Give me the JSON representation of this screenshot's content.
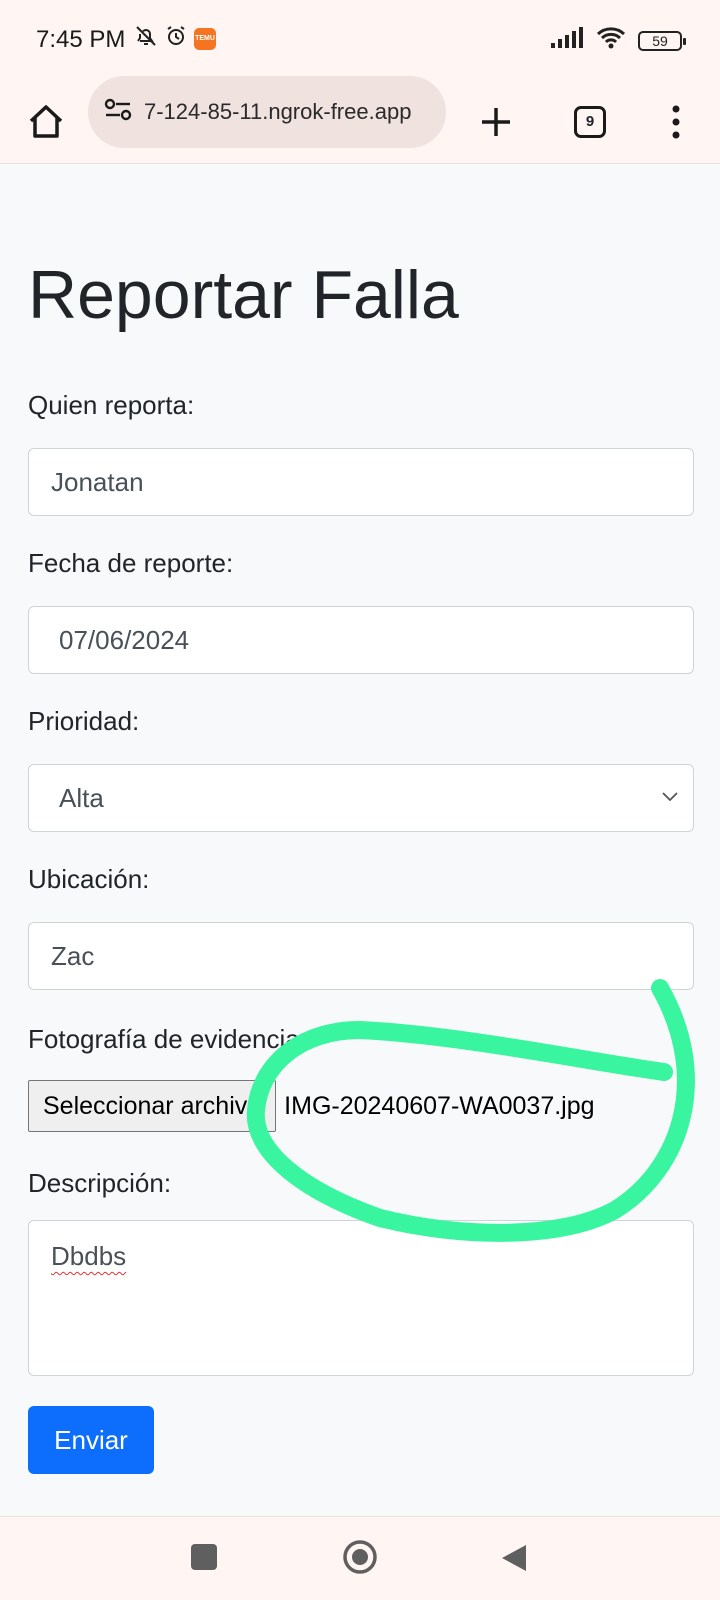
{
  "status_bar": {
    "time": "7:45 PM",
    "battery": "59",
    "icons": [
      "bell-off-icon",
      "alarm-icon",
      "temu-app-icon",
      "signal-icon",
      "wifi-icon",
      "battery-icon"
    ],
    "temu_badge_text": "TEMU"
  },
  "browser": {
    "url": "7-124-85-11.ngrok-free.app",
    "tab_count": "9"
  },
  "form": {
    "title": "Reportar Falla",
    "reporter_label": "Quien reporta:",
    "reporter_value": "Jonatan",
    "date_label": "Fecha de reporte:",
    "date_value": "07/06/2024",
    "priority_label": "Prioridad:",
    "priority_value": "Alta",
    "location_label": "Ubicación:",
    "location_value": "Zac",
    "photo_label": "Fotografía de evidencia:",
    "file_button_label": "Seleccionar archivo",
    "file_name": "IMG-20240607-WA0037.jpg",
    "description_label": "Descripción:",
    "description_value": "Dbdbs",
    "submit_label": "Enviar"
  },
  "colors": {
    "primary": "#0d6efd",
    "annotation": "#3af59f",
    "chrome_bg": "#fff5f3"
  }
}
